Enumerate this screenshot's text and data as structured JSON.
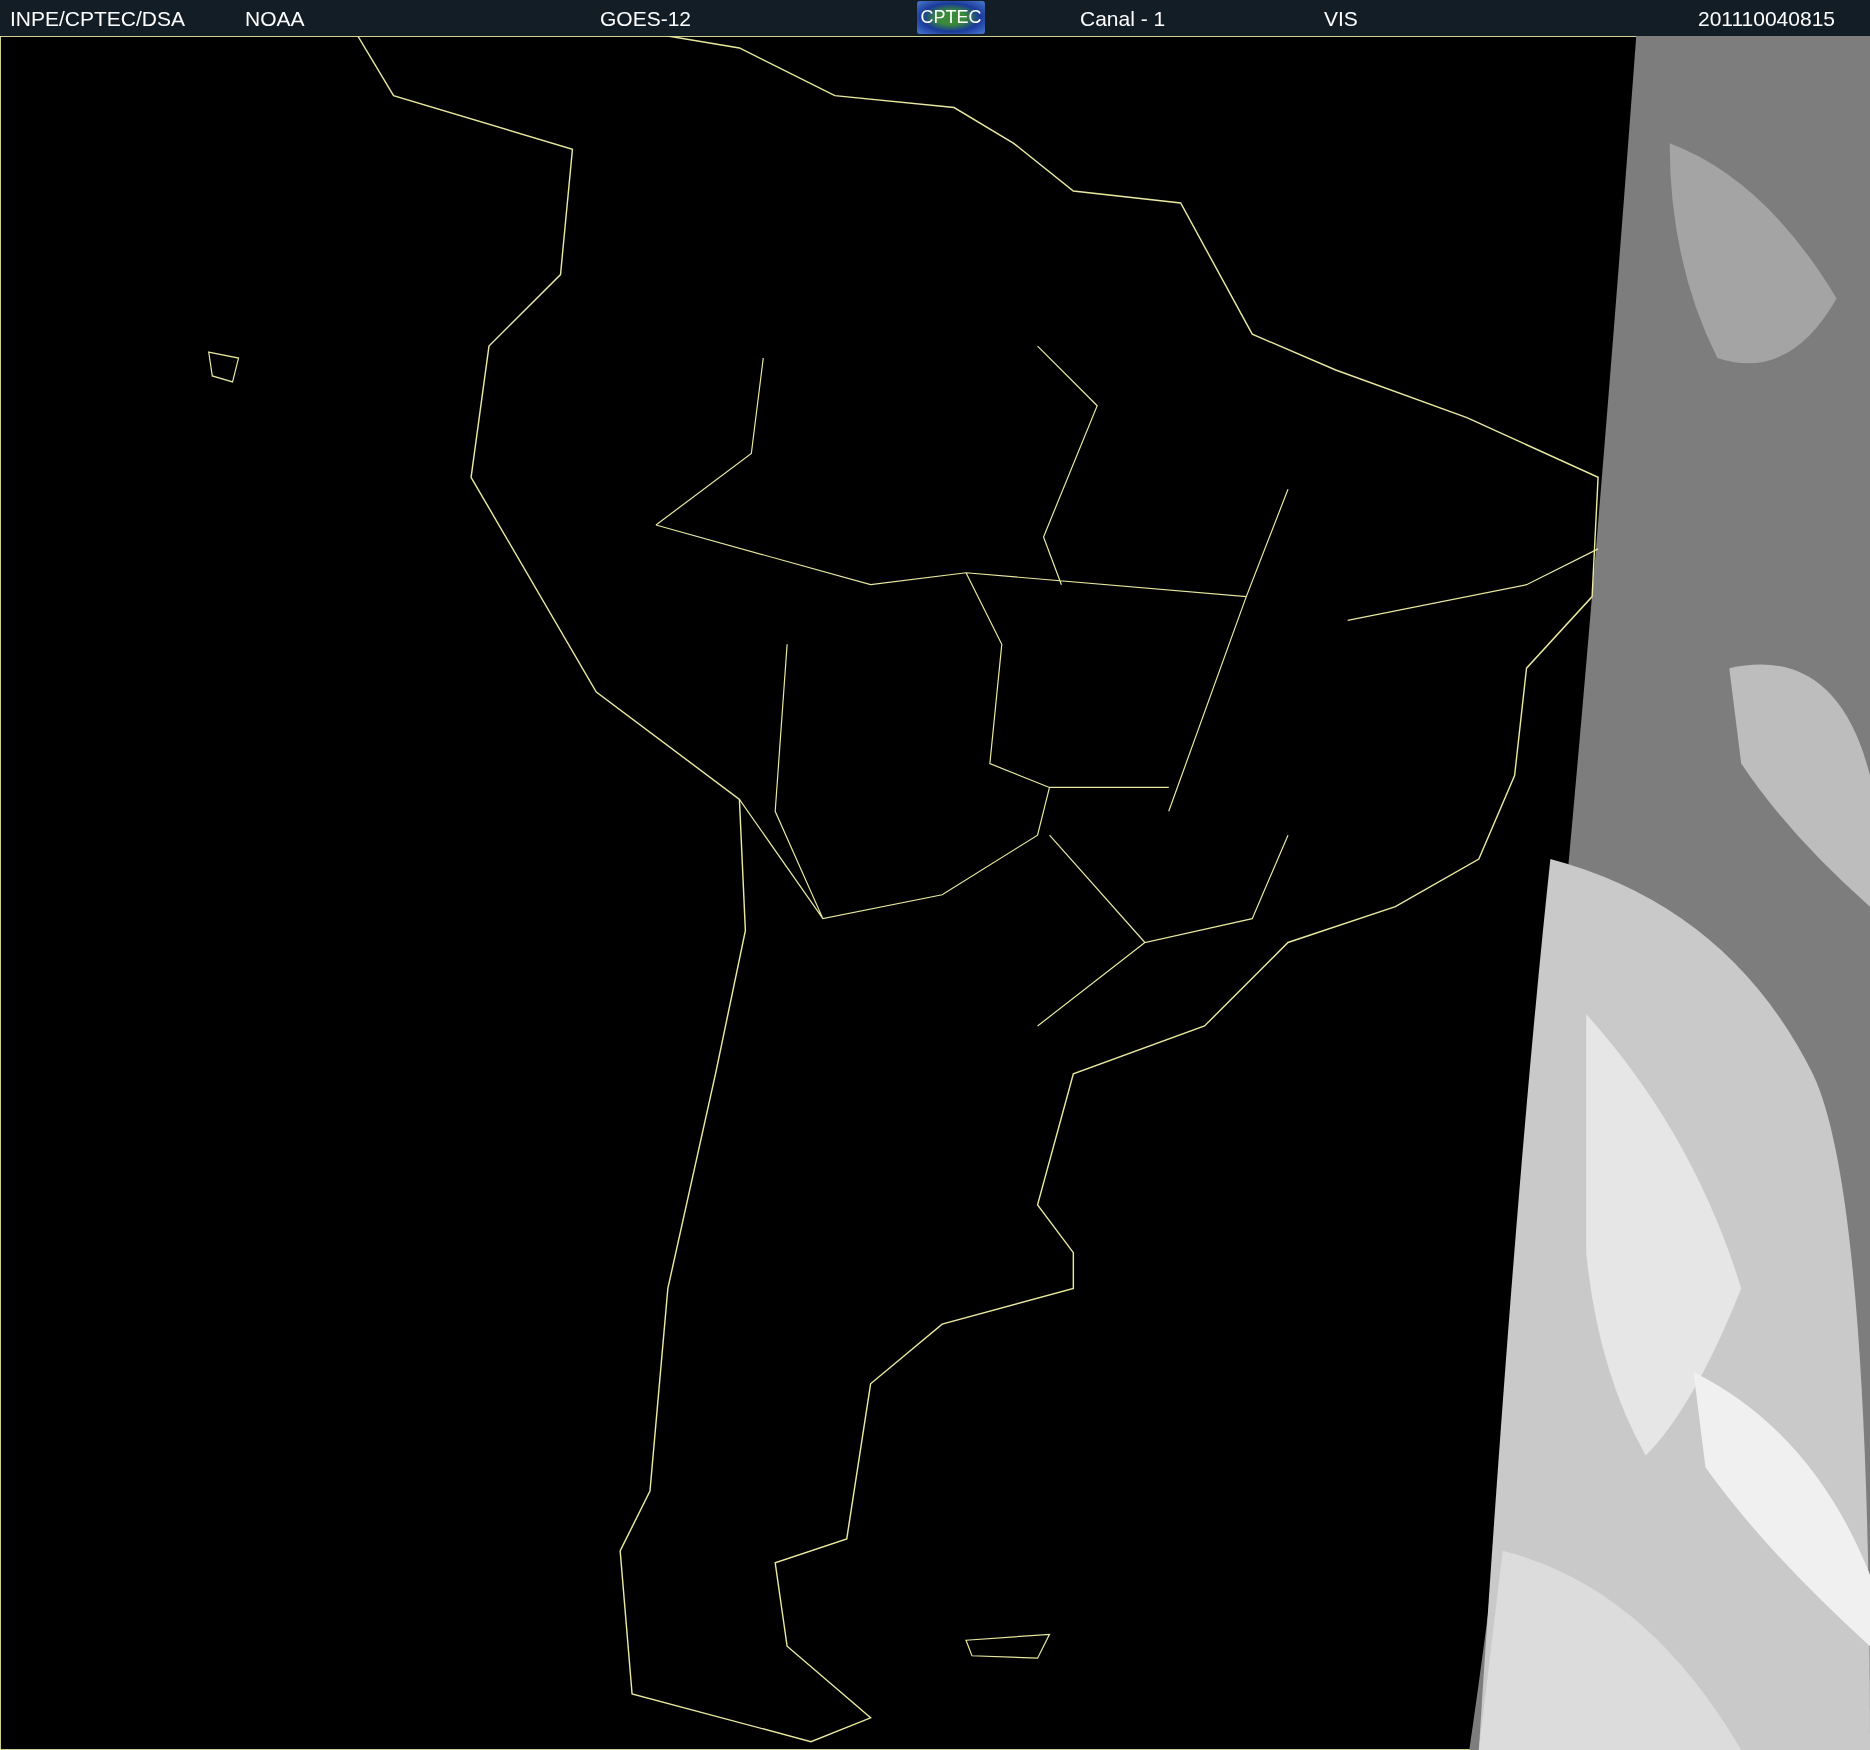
{
  "header": {
    "source": "INPE/CPTEC/DSA",
    "agency": "NOAA",
    "satellite": "GOES-12",
    "logo_text": "CPTEC",
    "channel": "Canal - 1",
    "band": "VIS",
    "timestamp": "201110040815"
  }
}
